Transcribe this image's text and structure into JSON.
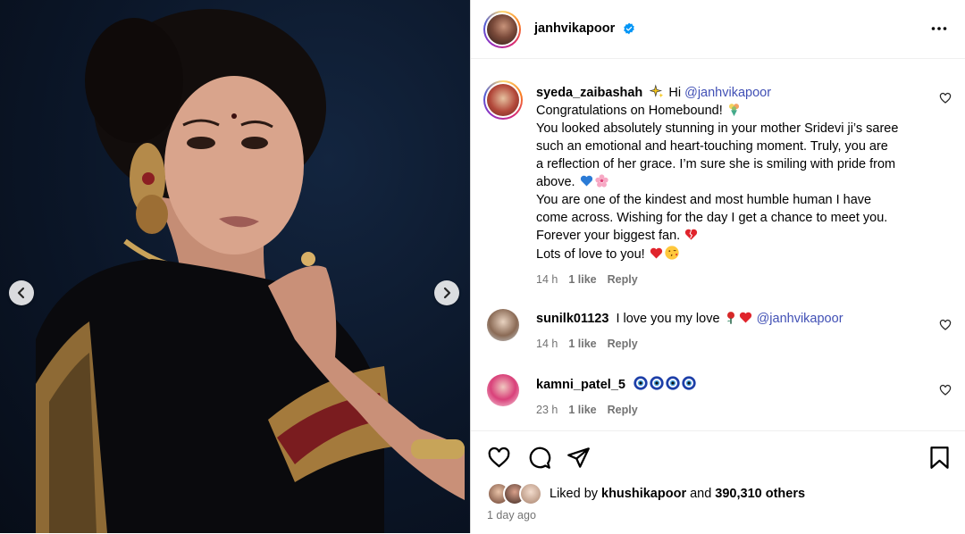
{
  "post": {
    "username": "janhvikapoor",
    "verified": true
  },
  "comments": [
    {
      "user": "syeda_zaibashah",
      "lines": [
        "Hi @janhvikapoor",
        "Congratulations on Homebound!",
        "You looked absolutely stunning in your mother Sridevi ji’s saree",
        "such an emotional and heart-touching moment. Truly, you are",
        "a reflection of her grace. I’m sure she is smiling with pride from",
        "above.",
        "You are one of the kindest and most humble human I have",
        "come across. Wishing for the day I get a chance to meet you.",
        "Forever your biggest fan.",
        "Lots of love to you!"
      ],
      "prefix_text": "Hi",
      "mention": "@janhvikapoor",
      "time": "14 h",
      "likes": "1 like",
      "reply": "Reply"
    },
    {
      "user": "sunilk01123",
      "text": "I love you my love",
      "mention": "@janhvikapoor",
      "time": "14 h",
      "likes": "1 like",
      "reply": "Reply"
    },
    {
      "user": "kamni_patel_5",
      "text": "",
      "time": "23 h",
      "likes": "1 like",
      "reply": "Reply"
    }
  ],
  "likes_summary": {
    "prefix": "Liked by",
    "user": "khushikapoor",
    "and": "and",
    "others": "390,310 others"
  },
  "post_time": "1 day ago",
  "icons": {
    "prev": "chevron-left-icon",
    "next": "chevron-right-icon",
    "more": "more-horizontal-icon",
    "like": "heart-icon",
    "comment": "comment-icon",
    "share": "send-icon",
    "save": "bookmark-icon"
  },
  "colors": {
    "verified": "#0095f6",
    "mention": "#4150b5",
    "meta": "#737373",
    "photo_bg": "#0b1628"
  }
}
